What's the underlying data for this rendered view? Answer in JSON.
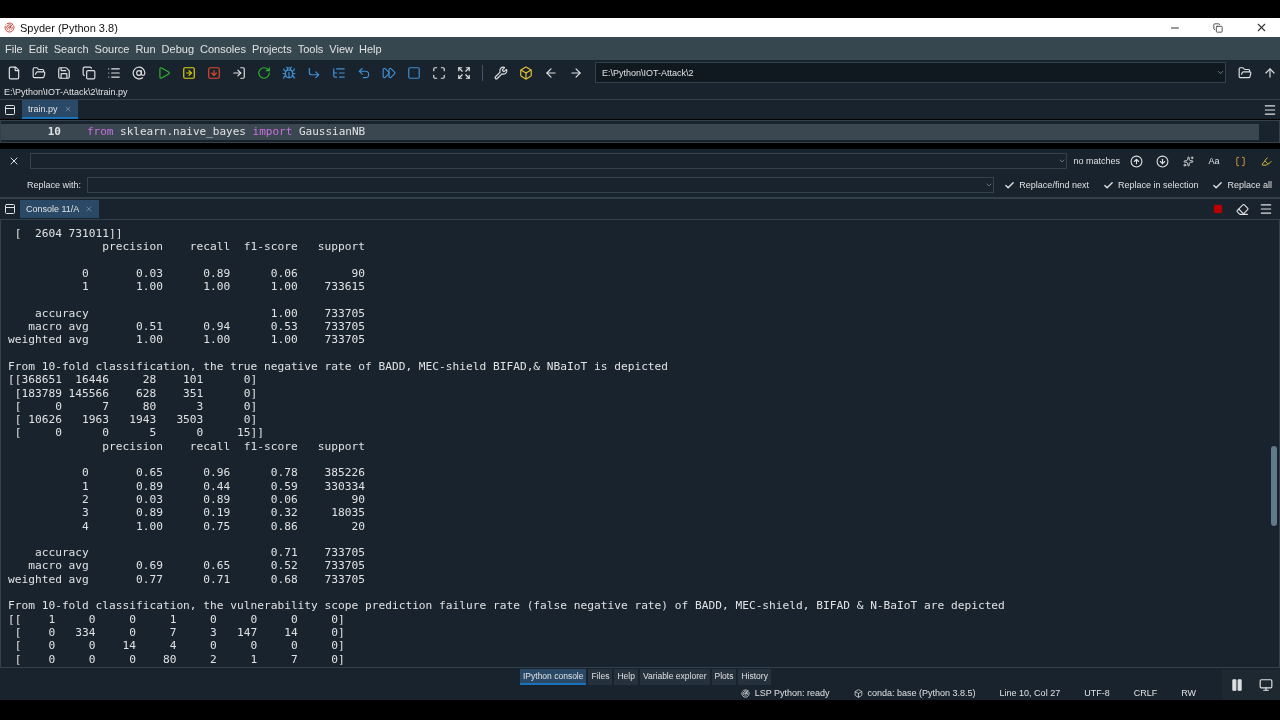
{
  "window": {
    "title": "Spyder (Python 3.8)"
  },
  "menu": [
    "File",
    "Edit",
    "Search",
    "Source",
    "Run",
    "Debug",
    "Consoles",
    "Projects",
    "Tools",
    "View",
    "Help"
  ],
  "working_directory": "E:\\Python\\IOT-Attack\\2",
  "file_path": "E:\\Python\\IOT-Attack\\2\\train.py",
  "editor": {
    "tabs": [
      {
        "label": "train.py",
        "selected": true
      }
    ],
    "lines": [
      {
        "number": "10",
        "tokens": [
          {
            "kind": "keyword",
            "text": "from"
          },
          {
            "kind": "plain",
            "text": " sklearn.naive_bayes "
          },
          {
            "kind": "keyword",
            "text": "import"
          },
          {
            "kind": "plain",
            "text": " GaussianNB"
          }
        ]
      }
    ]
  },
  "find": {
    "status": "no matches",
    "replace_label": "Replace with:",
    "toggles": [
      "Aa"
    ],
    "buttons": [
      "Replace/find next",
      "Replace in selection",
      "Replace all"
    ]
  },
  "console": {
    "tab": "Console 11/A",
    "lines": [
      {
        "kind": "text",
        "text": " [  2604 731011]]"
      },
      {
        "kind": "text",
        "text": "              precision    recall  f1-score   support"
      },
      {
        "kind": "blank"
      },
      {
        "kind": "text",
        "text": "           0       0.03      0.89      0.06        90"
      },
      {
        "kind": "text",
        "text": "           1       1.00      1.00      1.00    733615"
      },
      {
        "kind": "blank"
      },
      {
        "kind": "text",
        "text": "    accuracy                           1.00    733705"
      },
      {
        "kind": "text",
        "text": "   macro avg       0.51      0.94      0.53    733705"
      },
      {
        "kind": "text",
        "text": "weighted avg       1.00      1.00      1.00    733705"
      },
      {
        "kind": "blank"
      },
      {
        "kind": "text",
        "text": "From 10-fold classification, the true negative rate of BADD, MEC-shield BIFAD,& NBaIoT is depicted"
      },
      {
        "kind": "text",
        "text": "[[368651  16446     28    101      0]"
      },
      {
        "kind": "text",
        "text": " [183789 145566    628    351      0]"
      },
      {
        "kind": "text",
        "text": " [     0      7     80      3      0]"
      },
      {
        "kind": "text",
        "text": " [ 10626   1963   1943   3503      0]"
      },
      {
        "kind": "text",
        "text": " [     0      0      5      0     15]]"
      },
      {
        "kind": "text",
        "text": "              precision    recall  f1-score   support"
      },
      {
        "kind": "blank"
      },
      {
        "kind": "text",
        "text": "           0       0.65      0.96      0.78    385226"
      },
      {
        "kind": "text",
        "text": "           1       0.89      0.44      0.59    330334"
      },
      {
        "kind": "text",
        "text": "           2       0.03      0.89      0.06        90"
      },
      {
        "kind": "text",
        "text": "           3       0.89      0.19      0.32     18035"
      },
      {
        "kind": "text",
        "text": "           4       1.00      0.75      0.86        20"
      },
      {
        "kind": "blank"
      },
      {
        "kind": "text",
        "text": "    accuracy                           0.71    733705"
      },
      {
        "kind": "text",
        "text": "   macro avg       0.69      0.65      0.52    733705"
      },
      {
        "kind": "text",
        "text": "weighted avg       0.77      0.71      0.68    733705"
      },
      {
        "kind": "blank"
      },
      {
        "kind": "text",
        "text": "From 10-fold classification, the vulnerability scope prediction failure rate (false negative rate) of BADD, MEC-shield, BIFAD & N-BaIoT are depicted"
      },
      {
        "kind": "text",
        "text": "[[    1     0     0     1     0     0     0     0]"
      },
      {
        "kind": "text",
        "text": " [    0   334     0     7     3   147    14     0]"
      },
      {
        "kind": "text",
        "text": " [    0     0    14     4     0     0     0     0]"
      },
      {
        "kind": "text",
        "text": " [    0     0     0    80     2     1     7     0]"
      }
    ]
  },
  "pane_tabs": [
    {
      "label": "IPython console",
      "selected": true
    },
    {
      "label": "Files",
      "selected": false
    },
    {
      "label": "Help",
      "selected": false
    },
    {
      "label": "Variable explorer",
      "selected": false
    },
    {
      "label": "Plots",
      "selected": false
    },
    {
      "label": "History",
      "selected": false
    }
  ],
  "status_bar": [
    {
      "kind": "lsp",
      "text": "LSP Python: ready"
    },
    {
      "kind": "conda",
      "text": "conda: base (Python 3.8.5)"
    },
    {
      "kind": "plain",
      "text": "Line 10, Col 27"
    },
    {
      "kind": "plain",
      "text": "UTF-8"
    },
    {
      "kind": "plain",
      "text": "CRLF"
    },
    {
      "kind": "plain",
      "text": "RW"
    }
  ]
}
